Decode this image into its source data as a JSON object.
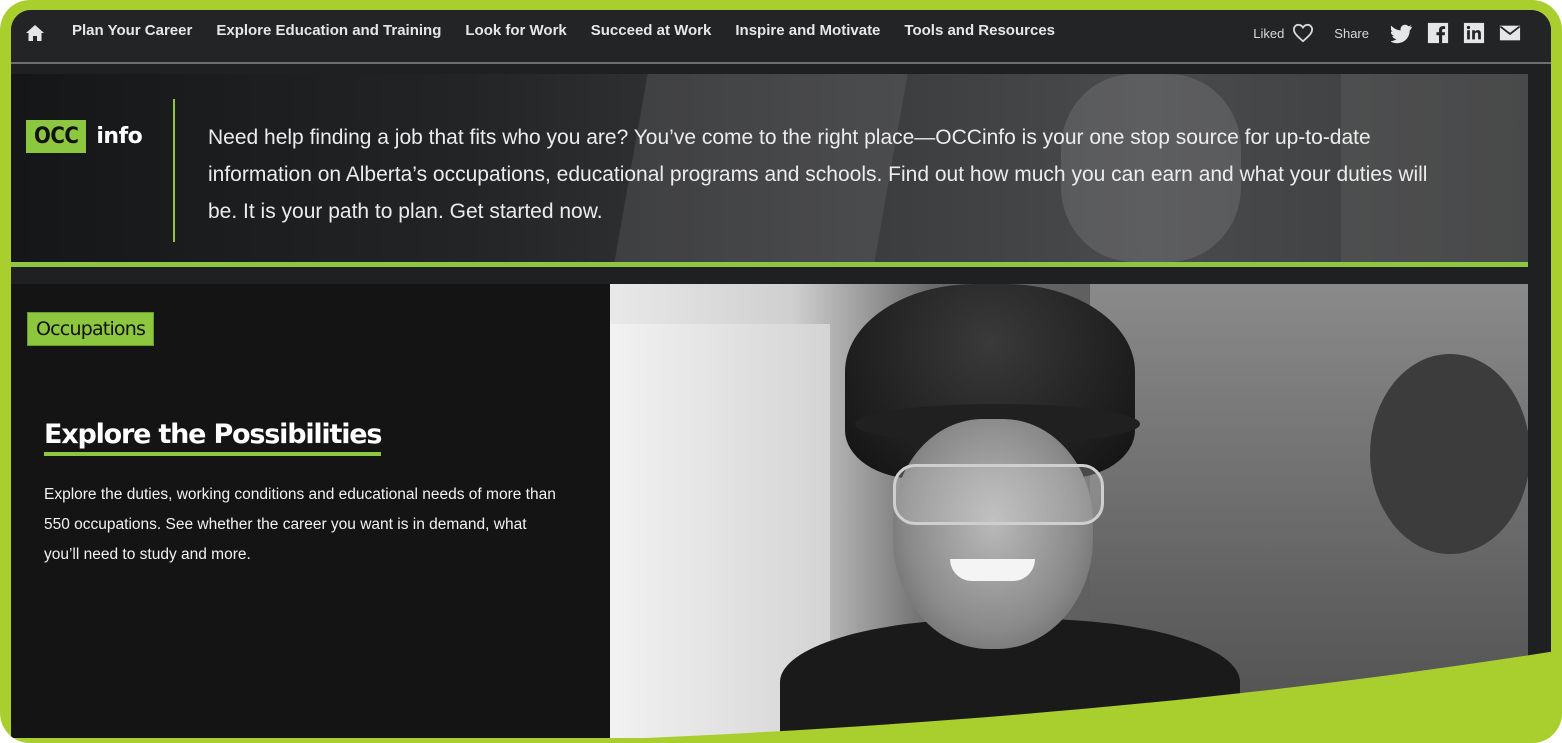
{
  "nav": {
    "links": [
      "Plan Your Career",
      "Explore Education and Training",
      "Look for Work",
      "Succeed at Work",
      "Inspire and Motivate",
      "Tools and Resources"
    ],
    "liked_label": "Liked",
    "share_label": "Share"
  },
  "banner": {
    "logo_occ": "OCC",
    "logo_info": "info",
    "text": "Need help finding a job that fits who you are? You’ve come to the right place—OCCinfo is your one stop source for up-to-date information on Alberta’s occupations, educational programs and schools. Find out how much you can earn and what your duties will be. It is your path to plan. Get started now."
  },
  "section": {
    "tag": "Occupations",
    "heading": "Explore the Possibilities",
    "description": "Explore the duties, working conditions and educational needs of more than 550 occupations. See whether the career you want is in demand, what you’ll need to study and more."
  },
  "colors": {
    "accent": "#8dc63f",
    "frame": "#a9cf2f",
    "background": "#1f2022"
  },
  "icons": [
    "home-icon",
    "heart-icon",
    "twitter-icon",
    "facebook-icon",
    "linkedin-icon",
    "email-icon"
  ]
}
